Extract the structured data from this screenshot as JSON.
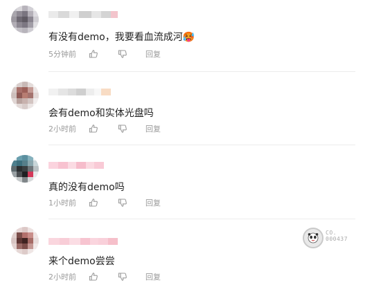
{
  "comments": [
    {
      "text": "有没有demo，我要看血流成河🥵",
      "time": "5分钟前",
      "reply": "回复",
      "like_icon": "thumbs-up-icon",
      "dislike_icon": "thumbs-down-icon"
    },
    {
      "text": "会有demo和实体光盘吗",
      "time": "2小时前",
      "reply": "回复",
      "like_icon": "thumbs-up-icon",
      "dislike_icon": "thumbs-down-icon"
    },
    {
      "text": "真的没有demo吗",
      "time": "1小时前",
      "reply": "回复",
      "like_icon": "thumbs-up-icon",
      "dislike_icon": "thumbs-down-icon"
    },
    {
      "text": "来个demo尝尝",
      "time": "2小时前",
      "reply": "回复",
      "like_icon": "thumbs-up-icon",
      "dislike_icon": "thumbs-down-icon",
      "badge_icon": "panda-badge-icon",
      "badge_lines": [
        "CO.",
        "000437"
      ]
    }
  ]
}
